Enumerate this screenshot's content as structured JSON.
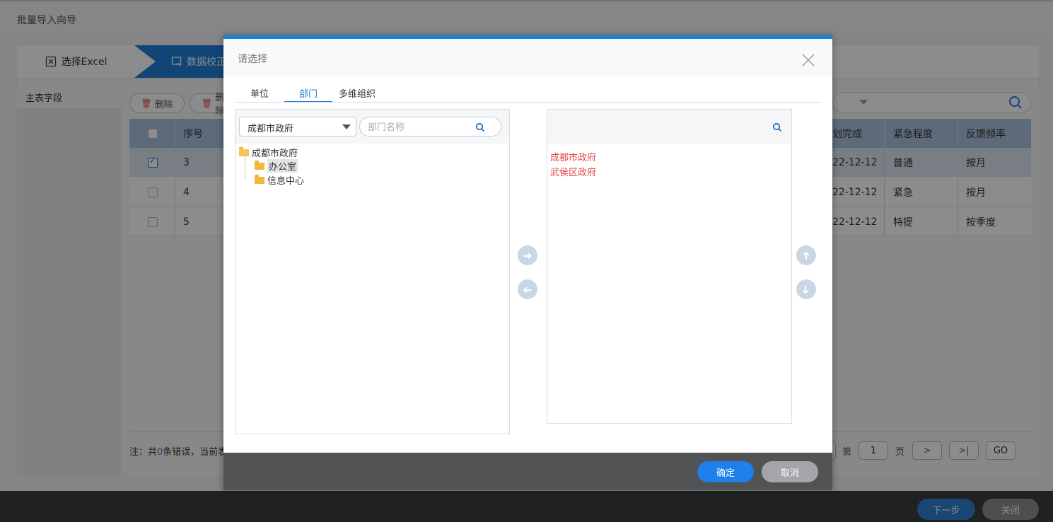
{
  "window": {
    "title": "批量导入向导"
  },
  "steps": [
    {
      "label": "选择Excel",
      "icon": "excel-icon"
    },
    {
      "label": "数据校正",
      "icon": "data-check-icon"
    }
  ],
  "left_panel": {
    "title": "主表字段"
  },
  "toolbar": {
    "delete_label": "删除",
    "delete_label_2": "删除"
  },
  "grid": {
    "columns": [
      "序号",
      "计划完成",
      "紧急程度",
      "反馈频率"
    ],
    "header_visible": {
      "seq": "序号",
      "plan": "划完成",
      "urgency": "紧急程度",
      "freq": "反馈频率"
    },
    "rows": [
      {
        "checked": true,
        "seq": "3",
        "plan": "22-12-12",
        "urgency": "普通",
        "freq": "按月"
      },
      {
        "checked": false,
        "seq": "4",
        "plan": "22-12-12",
        "urgency": "紧急",
        "freq": "按月"
      },
      {
        "checked": false,
        "seq": "5",
        "plan": "22-12-12",
        "urgency": "特提",
        "freq": "按季度"
      }
    ]
  },
  "footer": {
    "note_prefix": "注：共",
    "error_count": "0",
    "note_suffix": "条错误，当前表",
    "page_label_pre": "第",
    "page_value": "1",
    "page_label_post": "页",
    "go_label": "GO"
  },
  "bottom_bar": {
    "next_label": "下一步",
    "close_label": "关闭"
  },
  "dialog": {
    "title": "请选择",
    "tabs": [
      {
        "label": "单位",
        "active": false
      },
      {
        "label": "部门",
        "active": true
      },
      {
        "label": "多维组织",
        "active": false
      }
    ],
    "org_select": {
      "value": "成都市政府"
    },
    "dept_search": {
      "placeholder": "部门名称"
    },
    "tree": {
      "root": "成都市政府",
      "children": [
        "办公室",
        "信息中心"
      ]
    },
    "selected": [
      "成都市政府",
      "武侯区政府"
    ],
    "ok_label": "确定",
    "cancel_label": "取消"
  },
  "colors": {
    "accent": "#1a80e0",
    "selected_text": "#e34545",
    "header_bg": "#a9c2dd"
  }
}
